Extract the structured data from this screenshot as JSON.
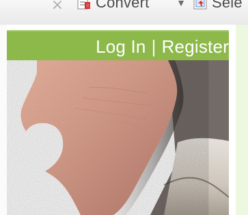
{
  "toolbar": {
    "close_glyph": "×",
    "convert_label": "Convert",
    "dropdown_glyph": "▼",
    "select_label": "Sele"
  },
  "header": {
    "login_label": "Log In",
    "separator": "|",
    "register_label": "Register"
  },
  "icons": {
    "convert_icon": "pdf-convert-icon",
    "select_icon": "select-icon",
    "close_icon": "close-icon",
    "dropdown_icon": "chevron-down-icon"
  },
  "colors": {
    "header_green": "#8db84a",
    "header_highlight": "#a2c96b",
    "right_panel": "#eef7df",
    "toolbar_bg": "#efefef"
  }
}
